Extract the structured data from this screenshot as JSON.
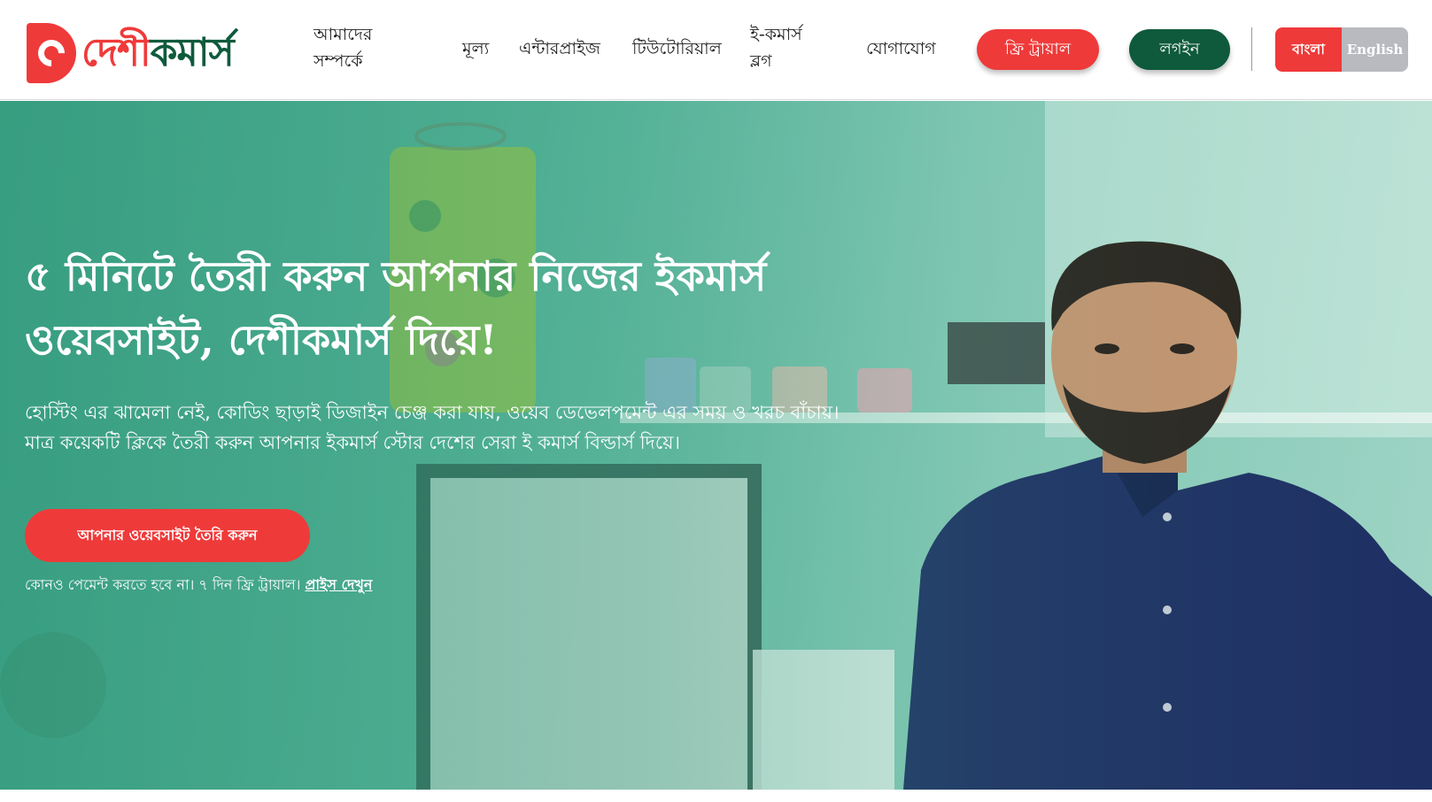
{
  "header": {
    "logo": {
      "text_red": "দেশী",
      "text_green": "কমার্স"
    },
    "nav": {
      "about_line1": "আমাদের",
      "about_line2": "সম্পর্কে",
      "price": "মূল্য",
      "enterprise": "এন্টারপ্রাইজ",
      "tutorial": "টিউটোরিয়াল",
      "blog_line1": "ই-কমার্স",
      "blog_line2": "ব্লগ",
      "contact": "যোগাযোগ"
    },
    "buttons": {
      "free_trial": "ফ্রি ট্রায়াল",
      "login": "লগইন"
    },
    "language": {
      "bangla": "বাংলা",
      "english": "English",
      "active": "bangla"
    }
  },
  "hero": {
    "title_line1": "৫ মিনিটে তৈরী করুন আপনার নিজের ইকমার্স",
    "title_line2": "ওয়েবসাইট, দেশীকমার্স দিয়ে!",
    "subtitle_line1": "হোস্টিং এর ঝামেলা নেই, কোডিং ছাড়াই ডিজাইন চেঞ্জ করা যায়, ওয়েব ডেভেলপমেন্ট এর সময় ও খরচ বাঁচায়।",
    "subtitle_line2": "মাত্র কয়েকটি ক্লিকে তৈরী করুন আপনার ইকমার্স স্টোর দেশের সেরা ই কমার্স বিল্ডার্স দিয়ে।",
    "cta": "আপনার ওয়েবসাইট তৈরি করুন",
    "note": "কোনও পেমেন্ট করতে হবে না। ৭ দিন ফ্রি ট্রায়াল।",
    "note_link": "প্রাইস দেখুন"
  },
  "colors": {
    "brand_red": "#ef3a3a",
    "brand_green": "#0f5a3c",
    "hero_tint": "#3aa384",
    "lang_inactive": "#b9bac0"
  },
  "icons": {
    "logo_mark": "c-ring-logo-icon"
  }
}
